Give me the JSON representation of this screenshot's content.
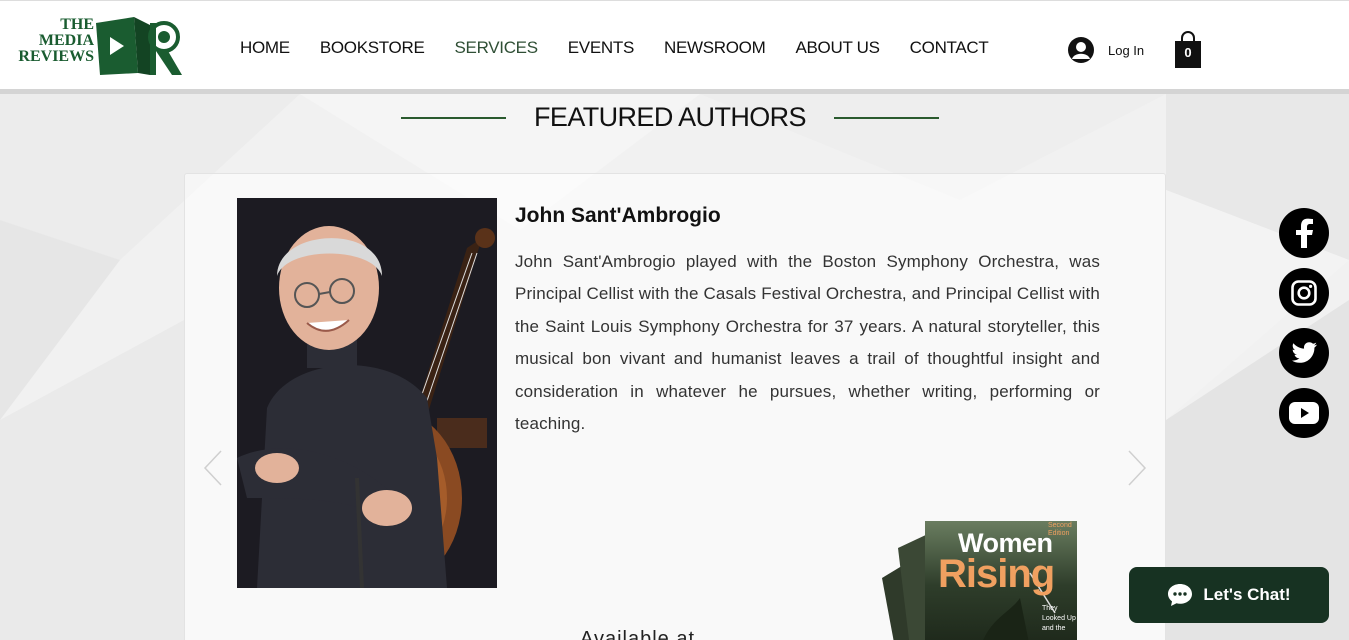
{
  "brand": {
    "line1": "THE",
    "line2": "MEDIA",
    "line3": "REVIEWS",
    "color": "#1a5c30"
  },
  "nav": [
    {
      "label": "HOME"
    },
    {
      "label": "BOOKSTORE"
    },
    {
      "label": "SERVICES",
      "active": true
    },
    {
      "label": "EVENTS"
    },
    {
      "label": "NEWSROOM"
    },
    {
      "label": "ABOUT US"
    },
    {
      "label": "CONTACT"
    }
  ],
  "account": {
    "login_label": "Log In",
    "cart_count": "0"
  },
  "section": {
    "title": "FEATURED AUTHORS",
    "accent": "#2a5a2e"
  },
  "author": {
    "name": "John Sant'Ambrogio",
    "bio": "John Sant'Ambrogio played with the Boston Symphony Orchestra, was Principal Cellist with the Casals Festival Orchestra, and Principal Cellist with the Saint Louis Symphony Orchestra for 37 years. A natural storyteller, this musical bon vivant and humanist leaves a trail of thoughtful insight and consideration in whatever he pursues, whether writing, performing or teaching."
  },
  "book": {
    "title_line1": "Women",
    "title_line2": "Rising",
    "edition": "Second Edition",
    "tagline": "They Looked Up and the"
  },
  "partial_text": "Available at",
  "social": [
    {
      "icon": "facebook-icon"
    },
    {
      "icon": "instagram-icon"
    },
    {
      "icon": "twitter-icon"
    },
    {
      "icon": "youtube-icon"
    }
  ],
  "chat": {
    "label": "Let's Chat!",
    "color": "#173222"
  }
}
